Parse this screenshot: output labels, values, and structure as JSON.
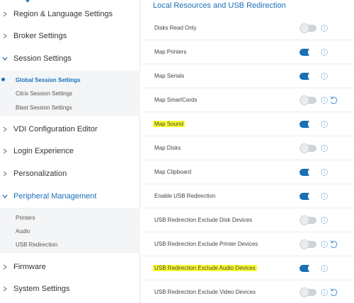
{
  "sidebar": {
    "items": [
      {
        "label": "Region & Language Settings"
      },
      {
        "label": "Broker Settings"
      },
      {
        "label": "Session Settings"
      },
      {
        "label": "VDI Configuration Editor"
      },
      {
        "label": "Login Experience"
      },
      {
        "label": "Personalization"
      },
      {
        "label": "Peripheral Management"
      },
      {
        "label": "Firmware"
      },
      {
        "label": "System Settings"
      }
    ],
    "session_sub": [
      {
        "label": "Global Session Settings",
        "active": true
      },
      {
        "label": "Citrix Session Settings"
      },
      {
        "label": "Blast Session Settings"
      }
    ],
    "peripheral_sub": [
      {
        "label": "Printers"
      },
      {
        "label": "Audio"
      },
      {
        "label": "USB Redirection"
      }
    ]
  },
  "main": {
    "title": "Local Resources and USB Redirection",
    "rows": [
      {
        "label": "Disks Read Only",
        "enabled": false
      },
      {
        "label": "Map Printers",
        "enabled": true
      },
      {
        "label": "Map Serials",
        "enabled": true
      },
      {
        "label": "Map SmartCards",
        "enabled": false
      },
      {
        "label": "Map Sound",
        "enabled": true,
        "highlight": true
      },
      {
        "label": "Map Disks",
        "enabled": false
      },
      {
        "label": "Map Clipboard",
        "enabled": true
      },
      {
        "label": "Enable USB Redirection",
        "enabled": true
      },
      {
        "label": "USB Redirection Exclude Disk Devices",
        "enabled": false
      },
      {
        "label": "USB Redirection Exclude Printer Devices",
        "enabled": false
      },
      {
        "label": "USB Redirection Exclude Audio Devices",
        "enabled": true,
        "highlight": true
      },
      {
        "label": "USB Redirection Exclude Video Devices",
        "enabled": false
      }
    ]
  },
  "icons": {
    "chevron": "chevron-right-icon",
    "info": "info-icon",
    "reset": "reset-icon"
  },
  "colors": {
    "accent": "#1a6fb8",
    "highlight": "#fdfd2e",
    "toggle_off": "#cfd3d6"
  }
}
